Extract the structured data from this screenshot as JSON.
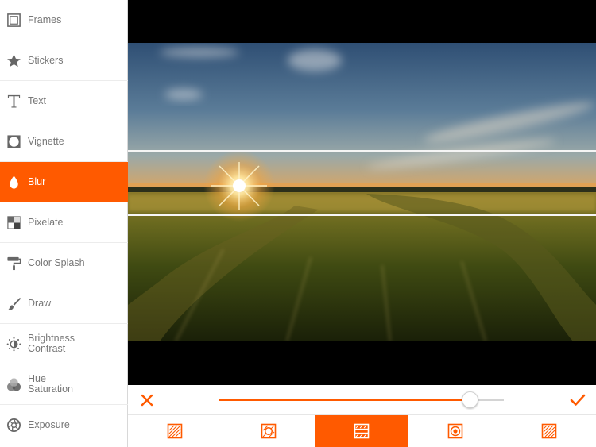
{
  "sidebar": {
    "items": [
      {
        "label": "Frames",
        "icon": "frames-icon"
      },
      {
        "label": "Stickers",
        "icon": "star-icon"
      },
      {
        "label": "Text",
        "icon": "text-icon"
      },
      {
        "label": "Vignette",
        "icon": "vignette-icon"
      },
      {
        "label": "Blur",
        "icon": "droplet-icon",
        "active": true
      },
      {
        "label": "Pixelate",
        "icon": "pixelate-icon"
      },
      {
        "label": "Color Splash",
        "icon": "paint-roller-icon"
      },
      {
        "label": "Draw",
        "icon": "brush-icon"
      },
      {
        "label": "Brightness",
        "label2": "Contrast",
        "icon": "brightness-icon"
      },
      {
        "label": "Hue",
        "label2": "Saturation",
        "icon": "hue-icon"
      },
      {
        "label": "Exposure",
        "icon": "aperture-icon"
      }
    ]
  },
  "blur_slider": {
    "value": 0.88
  },
  "modes": [
    {
      "name": "full-blur",
      "icon": "full-blur-icon"
    },
    {
      "name": "radial-blur",
      "icon": "radial-blur-icon"
    },
    {
      "name": "linear-blur",
      "icon": "linear-blur-icon",
      "active": true
    },
    {
      "name": "circle-blur",
      "icon": "circle-blur-icon"
    },
    {
      "name": "diagonal-blur",
      "icon": "diagonal-blur-icon"
    }
  ],
  "colors": {
    "accent": "#ff5a00",
    "sidebar_text": "#777777",
    "background": "#000000"
  }
}
